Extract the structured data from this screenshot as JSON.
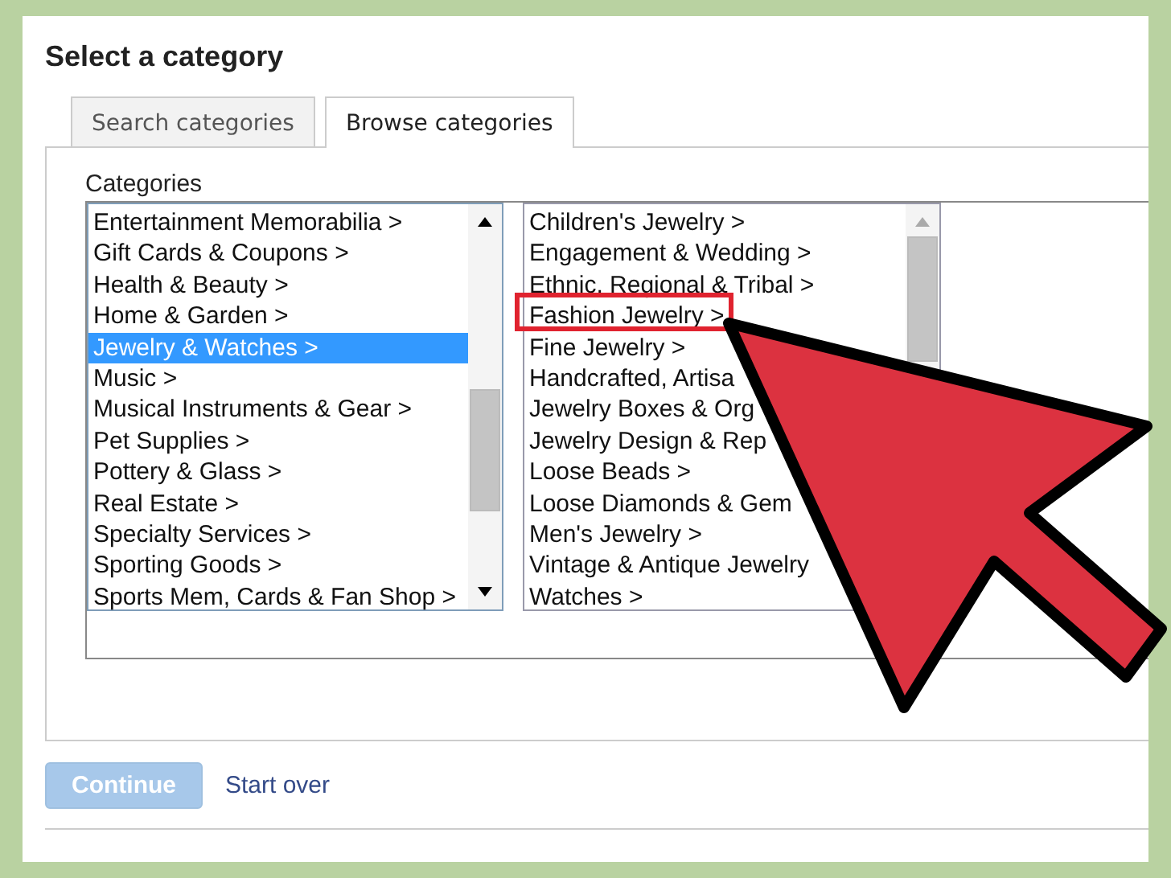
{
  "title": "Select a category",
  "tabs": [
    {
      "label": "Search categories",
      "selected": false
    },
    {
      "label": "Browse categories",
      "selected": true
    }
  ],
  "categories_label": "Categories",
  "lists": [
    {
      "items": [
        {
          "label": "Entertainment Memorabilia >",
          "selected": false
        },
        {
          "label": "Gift Cards & Coupons >",
          "selected": false
        },
        {
          "label": "Health & Beauty >",
          "selected": false
        },
        {
          "label": "Home & Garden >",
          "selected": false
        },
        {
          "label": "Jewelry & Watches >",
          "selected": true
        },
        {
          "label": "Music >",
          "selected": false
        },
        {
          "label": "Musical Instruments & Gear >",
          "selected": false
        },
        {
          "label": "Pet Supplies >",
          "selected": false
        },
        {
          "label": "Pottery & Glass >",
          "selected": false
        },
        {
          "label": "Real Estate >",
          "selected": false
        },
        {
          "label": "Specialty Services >",
          "selected": false
        },
        {
          "label": "Sporting Goods >",
          "selected": false
        },
        {
          "label": "Sports Mem, Cards & Fan Shop >",
          "selected": false
        }
      ]
    },
    {
      "items": [
        {
          "label": "Children's Jewelry >",
          "selected": false
        },
        {
          "label": "Engagement & Wedding >",
          "selected": false
        },
        {
          "label": "Ethnic, Regional & Tribal >",
          "selected": false
        },
        {
          "label": "Fashion Jewelry >",
          "selected": false,
          "highlighted": true
        },
        {
          "label": "Fine Jewelry >",
          "selected": false
        },
        {
          "label": "Handcrafted, Artisa",
          "selected": false
        },
        {
          "label": "Jewelry Boxes & Org",
          "selected": false
        },
        {
          "label": "Jewelry Design & Rep",
          "selected": false
        },
        {
          "label": "Loose Beads >",
          "selected": false
        },
        {
          "label": "Loose Diamonds & Gem",
          "selected": false
        },
        {
          "label": "Men's Jewelry >",
          "selected": false
        },
        {
          "label": "Vintage & Antique Jewelry",
          "selected": false
        },
        {
          "label": "Watches >",
          "selected": false
        }
      ]
    }
  ],
  "continue_button": {
    "label": "Continue",
    "disabled": true
  },
  "start_over_link": "Start over"
}
